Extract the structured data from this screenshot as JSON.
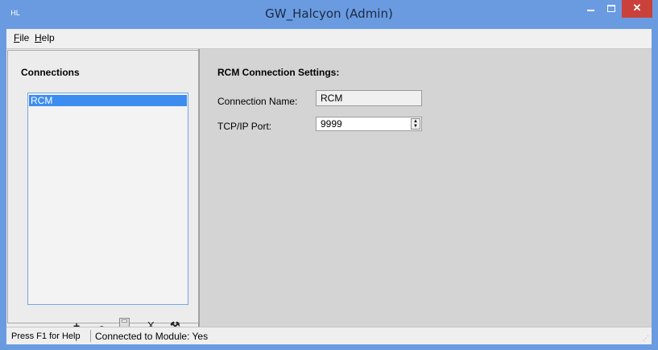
{
  "window": {
    "title": "GW_Halcyon (Admin)",
    "app_icon_glyph": "HL",
    "minimize_glyph": "",
    "maximize_glyph": "",
    "close_glyph": "✕"
  },
  "menu": {
    "file_u": "F",
    "file_rest": "ile",
    "help_u": "H",
    "help_rest": "elp"
  },
  "connections": {
    "title": "Connections",
    "items": [
      "RCM"
    ],
    "toolbar": {
      "add": "+",
      "remove": "-",
      "cancel": "X",
      "settings": "⚒"
    }
  },
  "settings": {
    "title": "RCM Connection Settings:",
    "connection_name_label": "Connection Name:",
    "connection_name_value": "RCM",
    "tcp_port_label": "TCP/IP Port:",
    "tcp_port_value": "9999",
    "spin_up": "▲",
    "spin_down": "▼"
  },
  "status": {
    "help": "Press F1 for Help",
    "connection": "Connected to Module: Yes"
  },
  "colors": {
    "titlebar": "#6a9be0",
    "close": "#c9413a",
    "selection": "#3d8df0"
  }
}
